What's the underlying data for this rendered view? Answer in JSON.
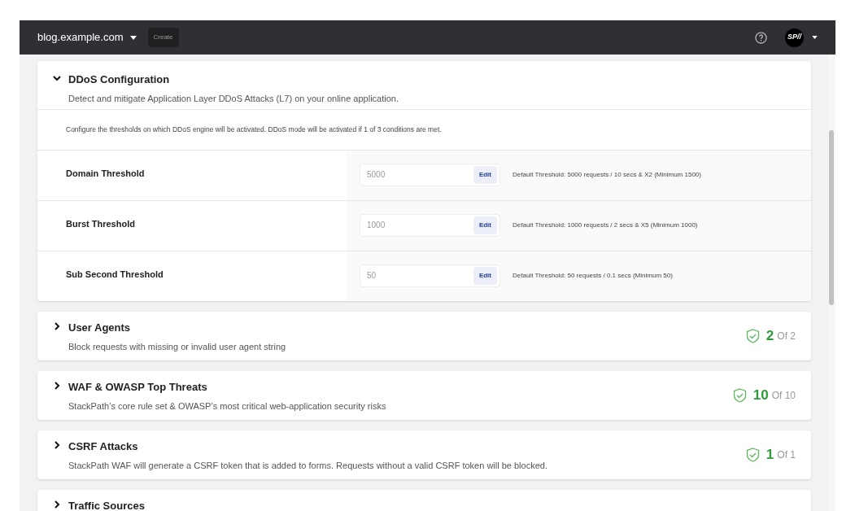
{
  "header": {
    "site": "blog.example.com",
    "create_button": "Create",
    "avatar": "SP//"
  },
  "ddos": {
    "title": "DDoS Configuration",
    "expanded": true,
    "description": "Detect and mitigate Application Layer DDoS Attacks (L7) on your online application.",
    "info": "Configure the thresholds on which DDoS engine will be activated. DDoS mode will be activated if 1 of 3 conditions are met.",
    "thresholds": [
      {
        "label": "Domain Threshold",
        "value": "5000",
        "button": "Edit",
        "hint": "Default Threshold: 5000 requests / 10 secs & X2 (Minimum 1500)"
      },
      {
        "label": "Burst Threshold",
        "value": "1000",
        "button": "Edit",
        "hint": "Default Threshold: 1000 requests / 2 secs & X5 (Minimum 1000)"
      },
      {
        "label": "Sub Second Threshold",
        "value": "50",
        "button": "Edit",
        "hint": "Default Threshold: 50 requests / 0.1 secs (Minimum 50)"
      }
    ]
  },
  "sections": [
    {
      "title": "User Agents",
      "expanded": false,
      "description": "Block requests with missing or invalid user agent string",
      "count": "2",
      "total": "Of 2"
    },
    {
      "title": "WAF & OWASP Top Threats",
      "expanded": false,
      "description": "StackPath’s core rule set & OWASP’s most critical web-application security risks",
      "count": "10",
      "total": "Of 10"
    },
    {
      "title": "CSRF Attacks",
      "expanded": false,
      "description": "StackPath WAF will generate a CSRF token that is added to forms. Requests without a valid CSRF token will be blocked.",
      "count": "1",
      "total": "Of 1"
    },
    {
      "title": "Traffic Sources",
      "expanded": false
    }
  ]
}
